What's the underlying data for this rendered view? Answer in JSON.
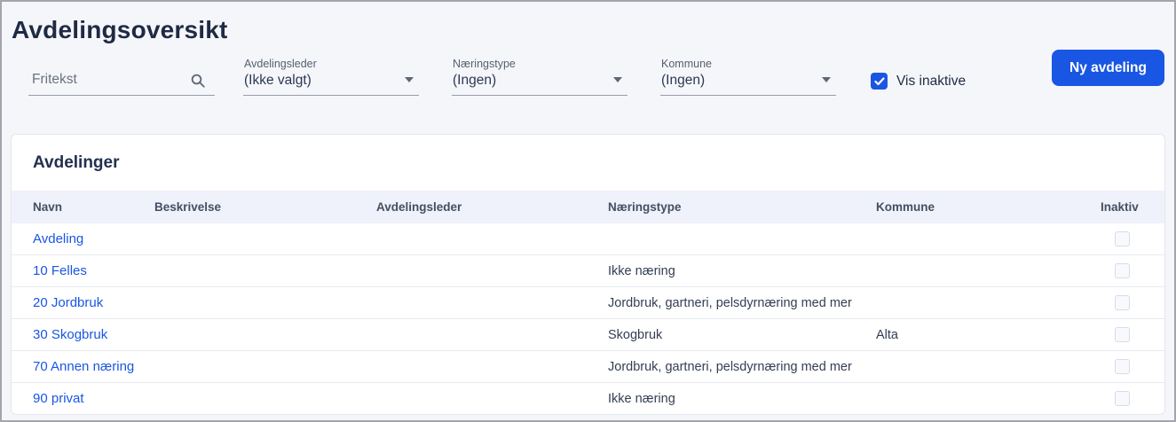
{
  "page": {
    "title": "Avdelingsoversikt"
  },
  "filters": {
    "fritekst": {
      "placeholder": "Fritekst",
      "value": "",
      "icon": "search-icon"
    },
    "avdelingsleder": {
      "label": "Avdelingsleder",
      "value": "(Ikke valgt)"
    },
    "naeringstype": {
      "label": "Næringstype",
      "value": "(Ingen)"
    },
    "kommune": {
      "label": "Kommune",
      "value": "(Ingen)"
    },
    "vis_inaktive": {
      "label": "Vis inaktive",
      "checked": true
    },
    "new_button_label": "Ny avdeling"
  },
  "table": {
    "title": "Avdelinger",
    "columns": {
      "navn": "Navn",
      "beskrivelse": "Beskrivelse",
      "avdelingsleder": "Avdelingsleder",
      "naeringstype": "Næringstype",
      "kommune": "Kommune",
      "inaktiv": "Inaktiv"
    },
    "rows": [
      {
        "navn": "Avdeling",
        "beskrivelse": "",
        "avdelingsleder": "",
        "naeringstype": "",
        "kommune": "",
        "inaktiv": false
      },
      {
        "navn": "10 Felles",
        "beskrivelse": "",
        "avdelingsleder": "",
        "naeringstype": "Ikke næring",
        "kommune": "",
        "inaktiv": false
      },
      {
        "navn": "20 Jordbruk",
        "beskrivelse": "",
        "avdelingsleder": "",
        "naeringstype": "Jordbruk, gartneri, pelsdyrnæring med mer",
        "kommune": "",
        "inaktiv": false
      },
      {
        "navn": "30 Skogbruk",
        "beskrivelse": "",
        "avdelingsleder": "",
        "naeringstype": "Skogbruk",
        "kommune": "Alta",
        "inaktiv": false
      },
      {
        "navn": "70 Annen næring",
        "beskrivelse": "",
        "avdelingsleder": "",
        "naeringstype": "Jordbruk, gartneri, pelsdyrnæring med mer",
        "kommune": "",
        "inaktiv": false
      },
      {
        "navn": "90 privat",
        "beskrivelse": "",
        "avdelingsleder": "",
        "naeringstype": "Ikke næring",
        "kommune": "",
        "inaktiv": false
      }
    ]
  },
  "colors": {
    "accent": "#1956e3",
    "page_background": "#f5f6fa",
    "table_header_background": "#eff1fb",
    "title_text": "#1f2a44"
  }
}
